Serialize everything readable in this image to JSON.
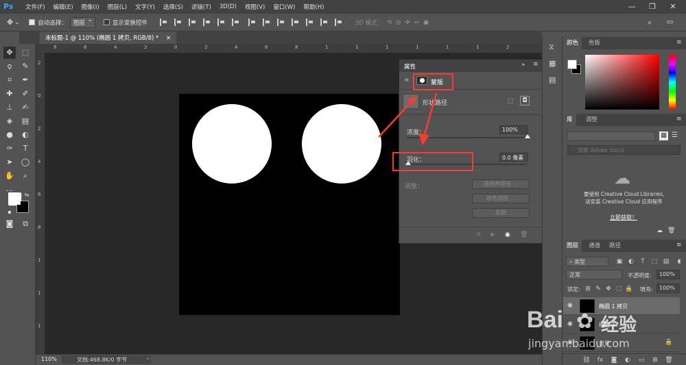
{
  "app": {
    "logo": "Ps",
    "menu": [
      "文件(F)",
      "编辑(E)",
      "图像(I)",
      "图层(L)",
      "文字(Y)",
      "选择(S)",
      "滤镜(T)",
      "3D(D)",
      "视图(V)",
      "窗口(W)",
      "帮助(H)"
    ],
    "window_controls": [
      "—",
      "❐",
      "✕"
    ]
  },
  "options_bar": {
    "auto_select_label": "自动选择：",
    "auto_select_value": "图层",
    "show_transform_label": "显示变换控件",
    "mode_3d_label": "3D 模式："
  },
  "document": {
    "tab_title": "未标题-1 @ 110% (椭圆 1 拷贝, RGB/8) *",
    "zoom": "110%",
    "doc_info": "文档:468.8K/0 字节"
  },
  "ruler": {
    "top_ticks": [
      "8",
      "6",
      "4",
      "2",
      "0",
      "2",
      "4",
      "6",
      "8",
      "1",
      "1",
      "1",
      "1",
      "1",
      "1",
      "2"
    ],
    "left_ticks": [
      "2",
      "0",
      "2",
      "4",
      "6",
      "8",
      "1",
      "1",
      "1"
    ]
  },
  "properties": {
    "title": "属性",
    "mask_label": "蒙版",
    "shape_path_label": "形状路径",
    "density_label": "浓度：",
    "density_value": "100%",
    "feather_label": "羽化：",
    "feather_value": "0.0 像素",
    "refine_label": "调整：",
    "select_mask_button": "选择并遮住 ...",
    "color_range_button": "颜色范围 ...",
    "invert_button": "反相",
    "density_level": 1.0,
    "feather_level": 0.0
  },
  "color_panel": {
    "tabs": [
      "颜色",
      "色板"
    ],
    "fg": "#ffffff",
    "bg": "#000000"
  },
  "library_panel": {
    "tabs": [
      "库",
      "调整"
    ],
    "search_placeholder": "搜索 Adobe Stock",
    "message_line1": "要使用 Creative Cloud Libraries,",
    "message_line2": "请安装 Creative Cloud 应用程序",
    "install_link": "立即获取！"
  },
  "layers_panel": {
    "tabs": [
      "图层",
      "通道",
      "路径"
    ],
    "filter_label": "类型",
    "blend_mode": "正常",
    "opacity_label": "不透明度:",
    "opacity_value": "100%",
    "lock_label": "锁定:",
    "fill_label": "填充:",
    "fill_value": "100%",
    "layers": [
      {
        "name": "椭圆 1 拷贝"
      },
      {
        "name": "椭圆 1"
      },
      {
        "name": "背景"
      }
    ]
  },
  "watermark": {
    "brand": "Bai",
    "brand_cn": "经验",
    "url": "jingyan.baidu.com"
  },
  "colors": {
    "accent_red": "#ff3b30",
    "ps_blue": "#31a8ff",
    "link_blue": "#ffffff"
  }
}
